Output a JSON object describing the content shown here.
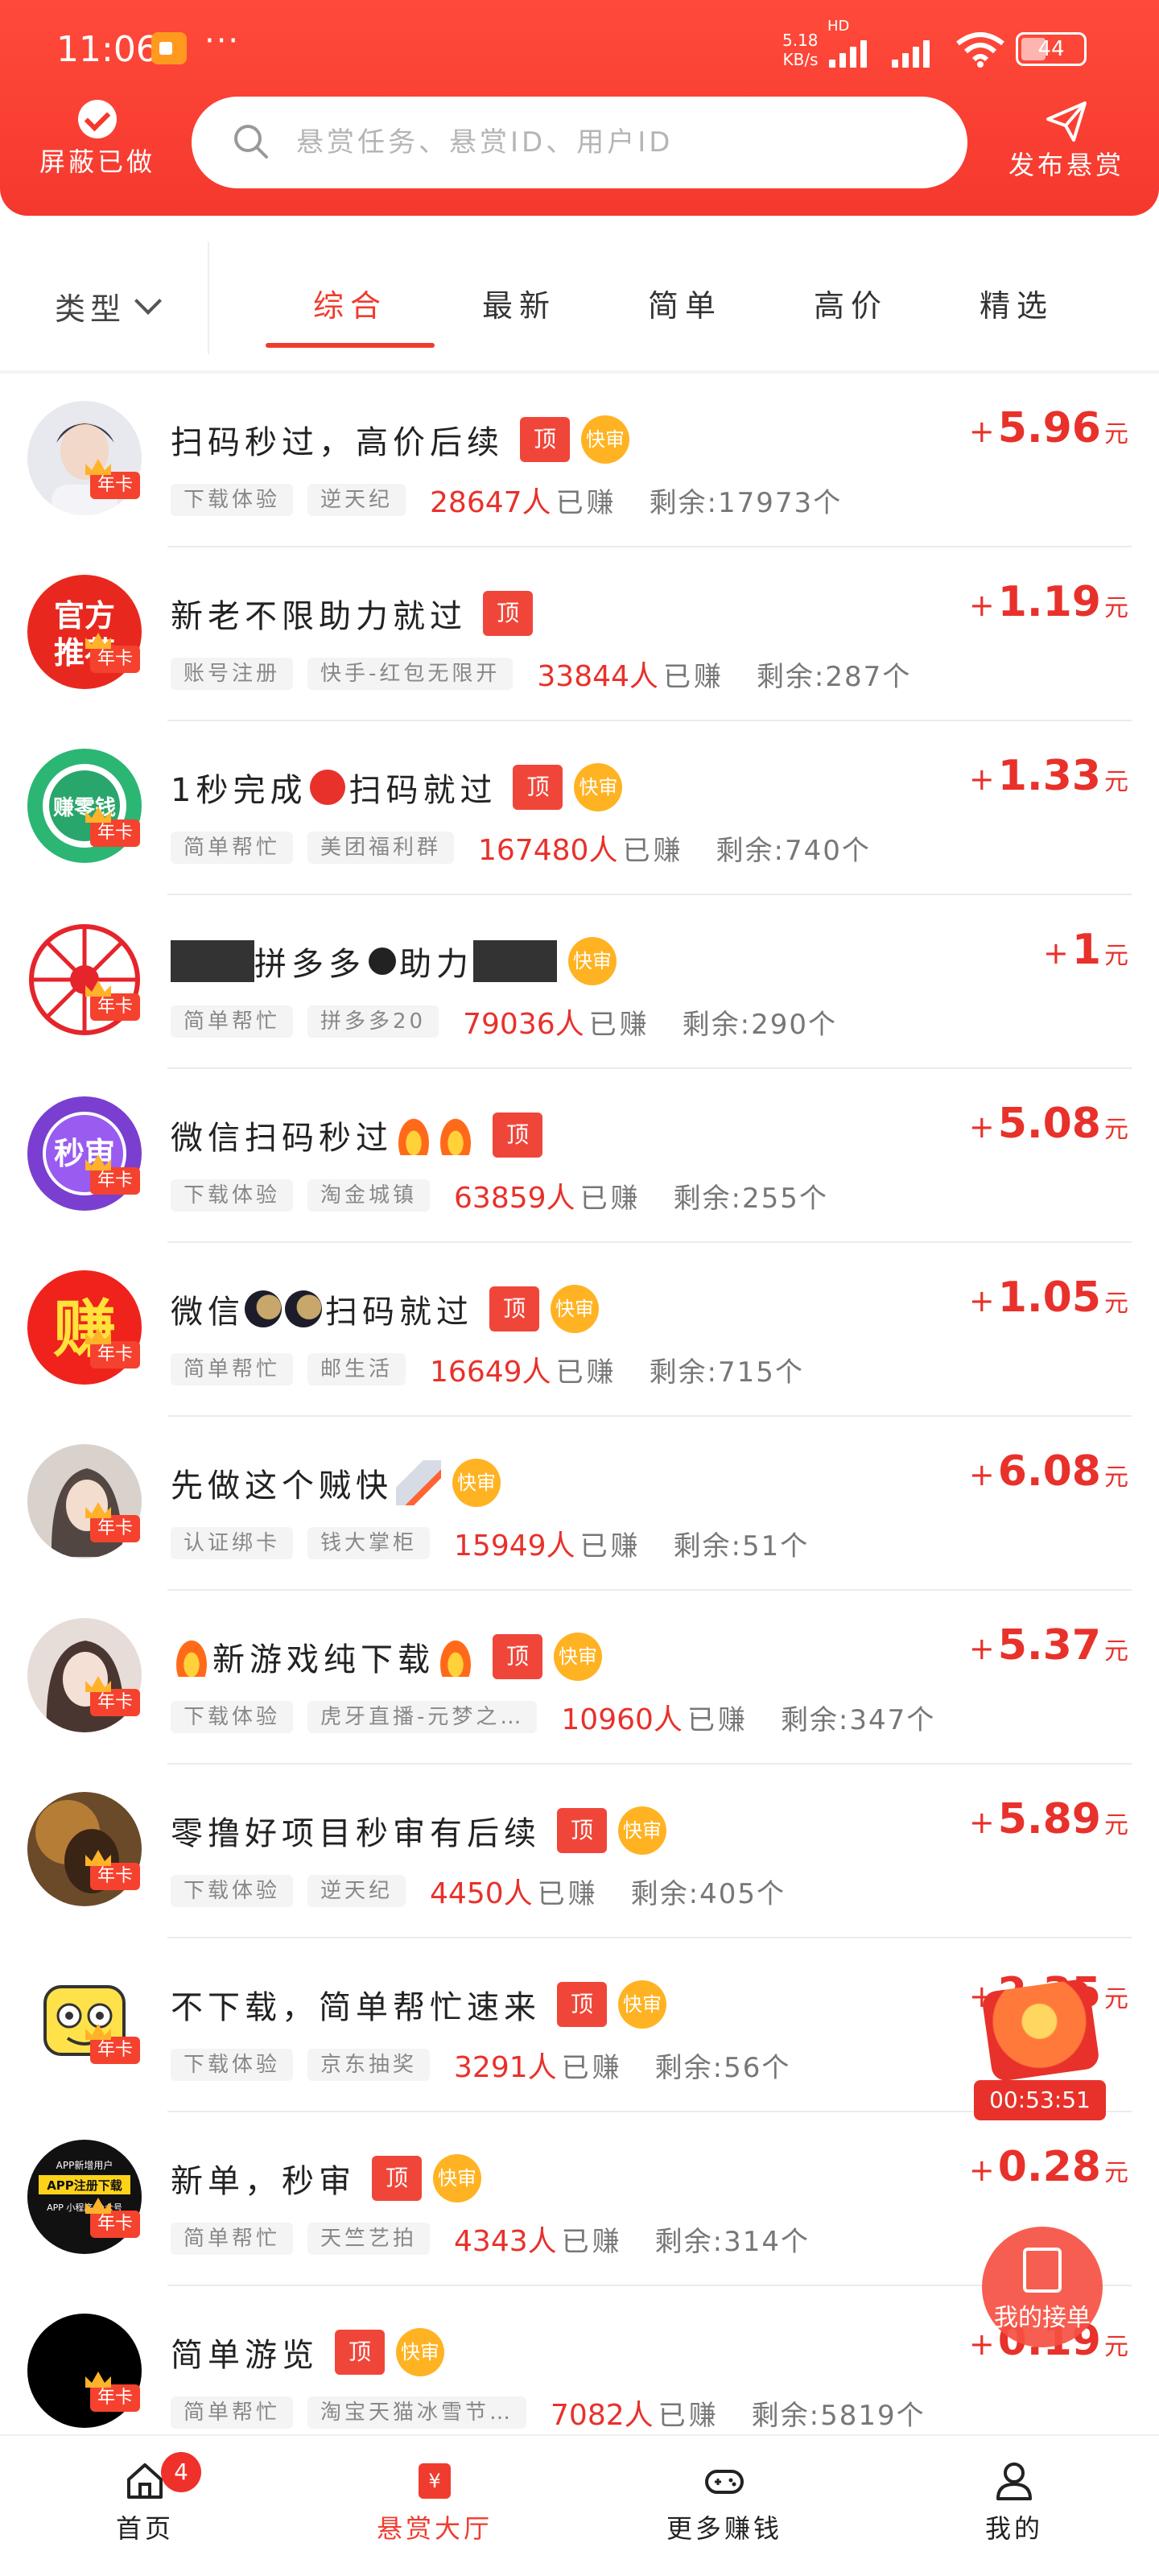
{
  "status_bar": {
    "time": "11:06",
    "dots": "···",
    "speed_value": "5.18",
    "speed_unit": "KB/s",
    "network": "HD",
    "battery": "44"
  },
  "header": {
    "block_label": "屏蔽已做",
    "search_placeholder": "悬赏任务、悬赏ID、用户ID",
    "publish_label": "发布悬赏"
  },
  "filter": {
    "type_label": "类型",
    "tabs": [
      {
        "label": "综合",
        "active": true
      },
      {
        "label": "最新",
        "active": false
      },
      {
        "label": "简单",
        "active": false
      },
      {
        "label": "高价",
        "active": false
      },
      {
        "label": "精选",
        "active": false
      }
    ]
  },
  "common": {
    "earned_suffix": "已赚",
    "remain_prefix": "剩余:",
    "remain_suffix": "个",
    "top_badge": "顶",
    "fast_badge": "快审",
    "vip_badge": "年卡",
    "plus": "+",
    "yuan": "元"
  },
  "tasks": [
    {
      "title": "扫码秒过，高价后续",
      "tag1": "下载体验",
      "tag2": "逆天纪",
      "count": "28647人",
      "remaining": "17973",
      "price": "5.96",
      "top": true,
      "fast": true
    },
    {
      "title": "新老不限助力就过",
      "tag1": "账号注册",
      "tag2": "快手-红包无限开",
      "count": "33844人",
      "remaining": "287",
      "price": "1.19",
      "top": true,
      "fast": false
    },
    {
      "title_a": "1秒完成",
      "title_b": "扫码就过",
      "tag1": "简单帮忙",
      "tag2": "美团福利群",
      "count": "167480人",
      "remaining": "740",
      "price": "1.33",
      "top": true,
      "fast": true
    },
    {
      "title_a": "拼多多",
      "title_b": "助力",
      "tag1": "简单帮忙",
      "tag2": "拼多多20",
      "count": "79036人",
      "remaining": "290",
      "price": "1",
      "top": false,
      "fast": true
    },
    {
      "title": "微信扫码秒过",
      "tag1": "下载体验",
      "tag2": "淘金城镇",
      "count": "63859人",
      "remaining": "255",
      "price": "5.08",
      "top": true,
      "fast": false
    },
    {
      "title_a": "微信",
      "title_b": "扫码就过",
      "tag1": "简单帮忙",
      "tag2": "邮生活",
      "count": "16649人",
      "remaining": "715",
      "price": "1.05",
      "top": true,
      "fast": true
    },
    {
      "title": "先做这个贼快",
      "tag1": "认证绑卡",
      "tag2": "钱大掌柜",
      "count": "15949人",
      "remaining": "51",
      "price": "6.08",
      "top": false,
      "fast": true
    },
    {
      "title": "新游戏纯下载",
      "tag1": "下载体验",
      "tag2": "虎牙直播-元梦之…",
      "count": "10960人",
      "remaining": "347",
      "price": "5.37",
      "top": true,
      "fast": true
    },
    {
      "title": "零撸好项目秒审有后续",
      "tag1": "下载体验",
      "tag2": "逆天纪",
      "count": "4450人",
      "remaining": "405",
      "price": "5.89",
      "top": true,
      "fast": true
    },
    {
      "title": "不下载，简单帮忙速来",
      "tag1": "下载体验",
      "tag2": "京东抽奖",
      "count": "3291人",
      "remaining": "56",
      "price": "2.35",
      "top": true,
      "fast": true
    },
    {
      "title": "新单，秒审",
      "tag1": "简单帮忙",
      "tag2": "天竺艺拍",
      "count": "4343人",
      "remaining": "314",
      "price": "0.28",
      "top": true,
      "fast": true
    },
    {
      "title": "简单游览",
      "tag1": "简单帮忙",
      "tag2": "淘宝天猫冰雪节…",
      "count": "7082人",
      "remaining": "5819",
      "price": "0.19",
      "top": true,
      "fast": true
    }
  ],
  "avatar_texts": {
    "official_top": "官方",
    "official_bottom": "推荐",
    "zero": "赚零钱",
    "miaoshen": "秒审",
    "zhuan": "赚",
    "app_line1": "APP新增用户",
    "app_line2": "APP注册下载",
    "app_line3": "APP 小程序 公众号"
  },
  "floating": {
    "timer": "00:53:51",
    "my_orders": "我的接单"
  },
  "bottom_nav": [
    {
      "label": "首页",
      "icon": "home-icon",
      "badge": "4"
    },
    {
      "label": "悬赏大厅",
      "icon": "reward-hall-icon",
      "active": true
    },
    {
      "label": "更多赚钱",
      "icon": "gamepad-icon"
    },
    {
      "label": "我的",
      "icon": "user-icon"
    }
  ],
  "colors": {
    "brand_red": "#f5382e",
    "price_red": "#e8312b",
    "fast_orange": "#ffb323"
  }
}
